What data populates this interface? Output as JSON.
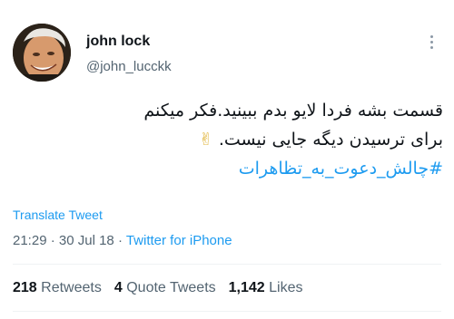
{
  "author": {
    "name": "john lock",
    "handle": "@john_lucckk",
    "avatar_icon": "profile-photo"
  },
  "more_icon": "more-dots-icon",
  "tweet": {
    "line1": "قسمت بشه فردا لایو بدم ببینید.فکر میکنم",
    "line2": "برای ترسیدن دیگه جایی نیست.",
    "emoji": "✌",
    "hashtag": "#چالش_دعوت_به_تظاهرات"
  },
  "translate_label": "Translate Tweet",
  "meta": {
    "time": "21:29",
    "sep1": " · ",
    "date": "30 Jul 18",
    "sep2": " · ",
    "source": "Twitter for iPhone"
  },
  "stats": {
    "retweets_count": "218",
    "retweets_label": "Retweets",
    "quotes_count": "4",
    "quotes_label": "Quote Tweets",
    "likes_count": "1,142",
    "likes_label": "Likes"
  },
  "colors": {
    "accent": "#1d9bf0",
    "text": "#0f1419",
    "muted": "#536471",
    "divider": "#eff3f4"
  }
}
